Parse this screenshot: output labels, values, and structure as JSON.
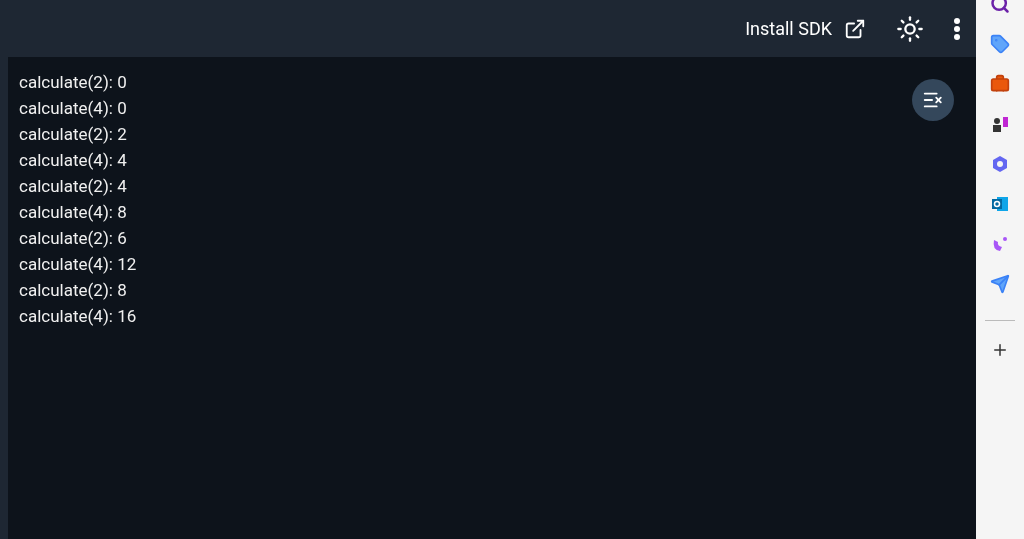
{
  "toolbar": {
    "install_link": "Install SDK"
  },
  "console": {
    "lines": [
      "calculate(2): 0",
      "calculate(4): 0",
      "calculate(2): 2",
      "calculate(4): 4",
      "calculate(2): 4",
      "calculate(4): 8",
      "calculate(2): 6",
      "calculate(4): 12",
      "calculate(2): 8",
      "calculate(4): 16"
    ]
  }
}
